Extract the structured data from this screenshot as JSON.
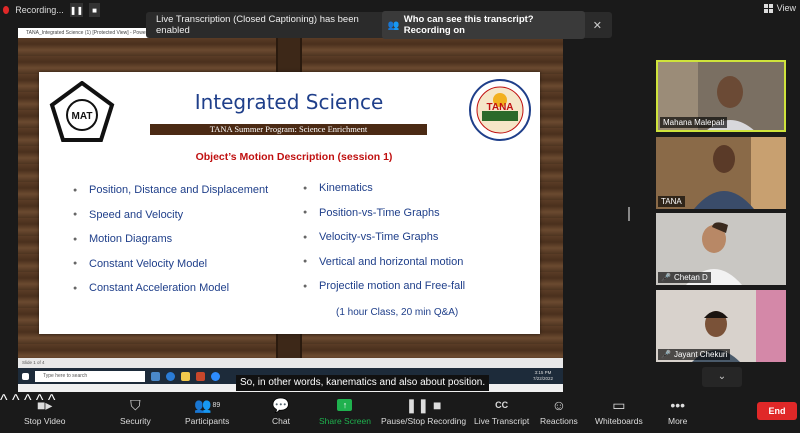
{
  "recording": {
    "label": "Recording...",
    "pause_icon": "pause-icon",
    "stop_icon": "stop-icon"
  },
  "view": {
    "label": "View"
  },
  "notification": {
    "text": "Live Transcription (Closed Captioning) has been enabled",
    "link": "Who can see this transcript? Recording on",
    "close": "✕"
  },
  "powerpoint": {
    "title_bar": "TANA_Integrated Science (1) [Protected View] - PowerPoint",
    "status_bar": "Slide 1 of 4",
    "search_placeholder": "Type here to search",
    "clock_time": "3:15 PM",
    "clock_date": "7/22/2022"
  },
  "slide": {
    "title": "Integrated Science",
    "subtitle": "TANA Summer Program: Science Enrichment",
    "heading": "Object’s Motion Description (session 1)",
    "left_bullets": [
      "Position, Distance and Displacement",
      "Speed and Velocity",
      "Motion Diagrams",
      "Constant Velocity Model",
      "Constant Acceleration Model"
    ],
    "right_bullets": [
      "Kinematics",
      "Position-vs-Time Graphs",
      "Velocity-vs-Time Graphs",
      "Vertical and horizontal motion",
      "Projectile motion and Free-fall"
    ],
    "note": "(1 hour Class, 20 min Q&A)",
    "mat_logo_text": "MAT",
    "tana_logo_text": "TANA"
  },
  "caption": "So, in other words, kanematics and also about position.",
  "participants": [
    {
      "name": "Mahana Malepati",
      "muted": false,
      "active": true,
      "bg": "#7a6f62",
      "skin": "#6b4a35"
    },
    {
      "name": "TANA",
      "muted": false,
      "active": false,
      "bg": "#8a6a48",
      "skin": "#5a3a28"
    },
    {
      "name": "Chetan D",
      "muted": true,
      "active": false,
      "bg": "#c9c7c3",
      "skin": "#b88866"
    },
    {
      "name": "Jayant Chekuri",
      "muted": true,
      "active": false,
      "bg": "#d8d2cc",
      "skin": "#7a5238"
    }
  ],
  "toolbar": {
    "stop_video": "Stop Video",
    "security": "Security",
    "participants": "Participants",
    "participants_count": "89",
    "chat": "Chat",
    "share_screen": "Share Screen",
    "pause_stop_recording": "Pause/Stop Recording",
    "live_transcript": "Live Transcript",
    "reactions": "Reactions",
    "whiteboards": "Whiteboards",
    "more": "More",
    "end": "End"
  },
  "colors": {
    "accent_green": "#1fb14e",
    "end_red": "#e02828",
    "active_border": "#cfe33b"
  }
}
